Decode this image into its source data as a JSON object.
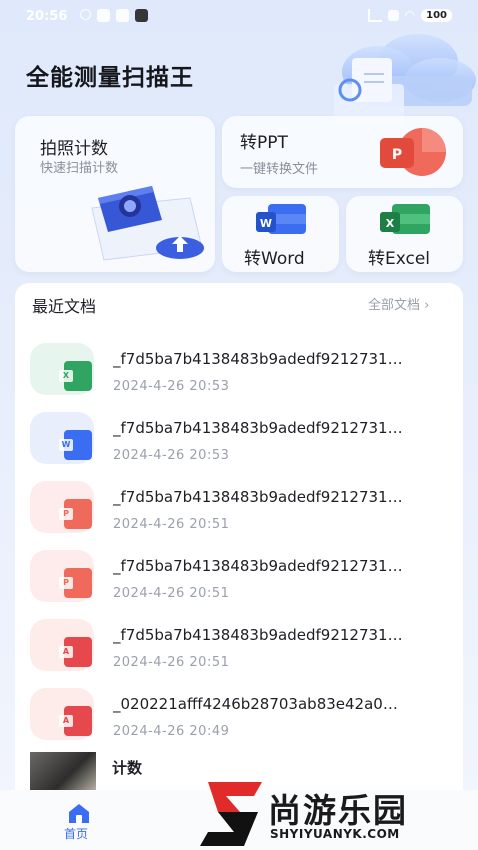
{
  "status_bar": {
    "time": "20:56",
    "battery": "100"
  },
  "app_title": "全能测量扫描王",
  "cards": {
    "count": {
      "title": "拍照计数",
      "subtitle": "快速扫描计数"
    },
    "ppt": {
      "title": "转PPT",
      "subtitle": "一键转换文件"
    },
    "word": {
      "title": "转Word"
    },
    "excel": {
      "title": "转Excel"
    }
  },
  "recent": {
    "title": "最近文档",
    "all_label": "全部文档 ›",
    "files": [
      {
        "name": "_f7d5ba7b4138483b9adedf9212731…",
        "date": "2024-4-26 20:53",
        "type": "excel",
        "color": "#2fa561",
        "bg": "#e6f6ef"
      },
      {
        "name": "_f7d5ba7b4138483b9adedf9212731…",
        "date": "2024-4-26 20:53",
        "type": "word",
        "color": "#3b6df2",
        "bg": "#e8eefc"
      },
      {
        "name": "_f7d5ba7b4138483b9adedf9212731…",
        "date": "2024-4-26 20:51",
        "type": "ppt",
        "color": "#ef6a5a",
        "bg": "#fdeceb"
      },
      {
        "name": "_f7d5ba7b4138483b9adedf9212731…",
        "date": "2024-4-26 20:51",
        "type": "ppt",
        "color": "#ef6a5a",
        "bg": "#fdeceb"
      },
      {
        "name": "_f7d5ba7b4138483b9adedf9212731…",
        "date": "2024-4-26 20:51",
        "type": "pdf",
        "color": "#e5484d",
        "bg": "#fdecea"
      },
      {
        "name": "_020221afff4246b28703ab83e42a0…",
        "date": "2024-4-26 20:49",
        "type": "pdf",
        "color": "#e5484d",
        "bg": "#fdecea"
      }
    ],
    "image_item": {
      "name": "计数"
    }
  },
  "nav": {
    "home_label": "首页"
  },
  "watermark": {
    "brand": "尚游乐园",
    "url": "SHYIYUANYK.COM"
  }
}
